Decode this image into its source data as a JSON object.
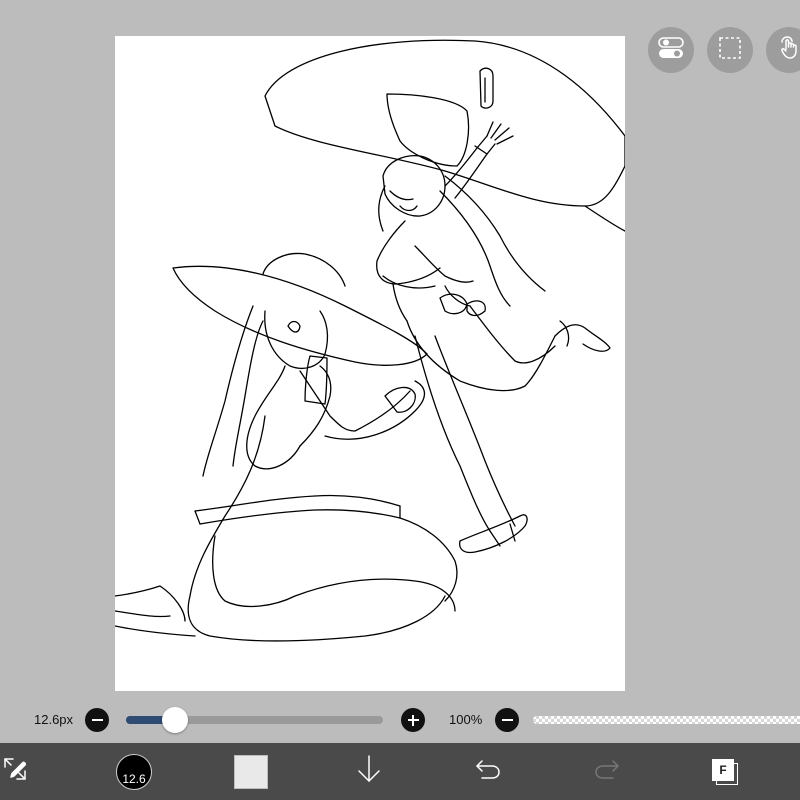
{
  "canvas": {
    "paper_color": "#ffffff",
    "background_color": "#bcbcbc"
  },
  "float_buttons": [
    {
      "name": "toggle-switch-icon"
    },
    {
      "name": "selection-icon"
    },
    {
      "name": "hand-touch-icon"
    }
  ],
  "brush_controls": {
    "size_label": "12.6px",
    "size_slider_fraction": 0.19,
    "opacity_label": "100%",
    "opacity_fraction": 1.0
  },
  "toolbar": {
    "brush_size_badge": "12.6",
    "current_color": "#e9e9e9",
    "layer_badge": "F"
  },
  "colors": {
    "toolbar_bg": "#4a4a4a",
    "slider_fill": "#2f4a73",
    "float_button_bg": "#9d9d9d"
  }
}
